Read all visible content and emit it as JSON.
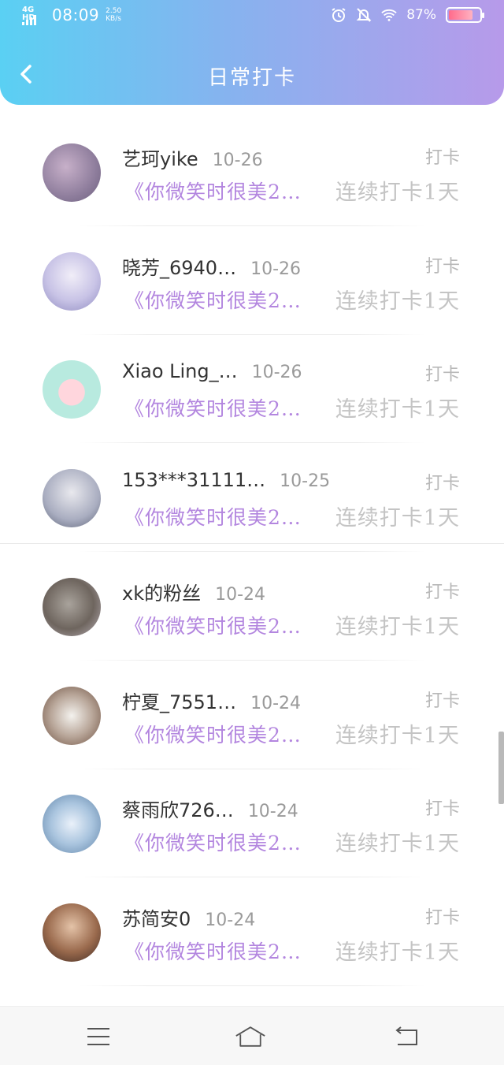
{
  "status_bar": {
    "network": "4G HD",
    "time": "08:09",
    "speed_value": "2.50",
    "speed_unit": "KB/s",
    "battery_percent": "87%",
    "icons": [
      "alarm-icon",
      "mute-bell-icon",
      "wifi-icon",
      "battery-icon"
    ]
  },
  "header": {
    "title": "日常打卡",
    "back_icon": "chevron-left-icon",
    "gradient": [
      "#5ad0f3",
      "#b79aea"
    ]
  },
  "records": [
    {
      "name": "艺珂yike",
      "date": "10-26",
      "label": "打卡",
      "book": "《你微笑时很美2…",
      "streak": "连续打卡1天",
      "avatar": "avatar-purple-moon"
    },
    {
      "name": "晓芳_6940…",
      "date": "10-26",
      "label": "打卡",
      "book": "《你微笑时很美2…",
      "streak": "连续打卡1天",
      "avatar": "avatar-anime-girl"
    },
    {
      "name": "Xiao Ling_…",
      "date": "10-26",
      "label": "打卡",
      "book": "《你微笑时很美2…",
      "streak": "连续打卡1天",
      "avatar": "avatar-heart-pandas"
    },
    {
      "name": "153***31111…",
      "date": "10-25",
      "label": "打卡",
      "book": "《你微笑时很美2…",
      "streak": "连续打卡1天",
      "avatar": "avatar-girl-photo"
    },
    {
      "name": "xk的粉丝",
      "date": "10-24",
      "label": "打卡",
      "book": "《你微笑时很美2…",
      "streak": "连续打卡1天",
      "avatar": "avatar-kitten"
    },
    {
      "name": "柠夏_7551…",
      "date": "10-24",
      "label": "打卡",
      "book": "《你微笑时很美2…",
      "streak": "连续打卡1天",
      "avatar": "avatar-cartoon-girls"
    },
    {
      "name": "蔡雨欣726…",
      "date": "10-24",
      "label": "打卡",
      "book": "《你微笑时很美2…",
      "streak": "连续打卡1天",
      "avatar": "avatar-blue-flowers"
    },
    {
      "name": "苏简安0",
      "date": "10-24",
      "label": "打卡",
      "book": "《你微笑时很美2…",
      "streak": "连续打卡1天",
      "avatar": "avatar-woman-photo"
    }
  ],
  "colors": {
    "book_title": "#b386df",
    "streak": "#c4c4c4",
    "label": "#b8b8b8",
    "name": "#333333",
    "date": "#9a9a9a"
  },
  "navbar": {
    "buttons": [
      "menu-icon",
      "home-icon",
      "back-arrow-icon"
    ]
  }
}
